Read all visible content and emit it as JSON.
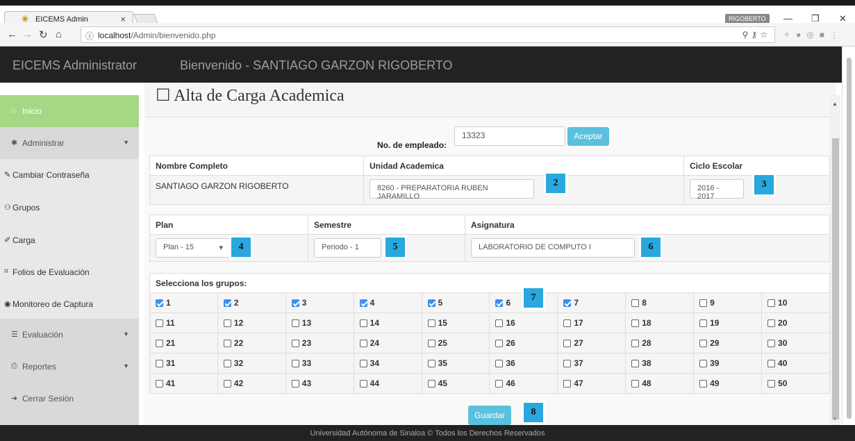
{
  "browser": {
    "tab_title": "EICEMS Admin",
    "tab_close": "×",
    "profile_name": "RIGOBERTO",
    "url_host": "localhost",
    "url_path": "/Admin/bienvenido.php"
  },
  "header": {
    "brand": "EICEMS Administrator",
    "welcome": "Bienvenido - SANTIAGO GARZON RIGOBERTO"
  },
  "sidebar": {
    "items": [
      {
        "label": "Inicio",
        "icon": "home-icon",
        "glyph": "⌂"
      },
      {
        "label": "Administrar",
        "icon": "gear-icon",
        "glyph": "✱"
      },
      {
        "label": "Cambiar Contraseña",
        "icon": "pencil-icon",
        "glyph": "✎"
      },
      {
        "label": "Grupos",
        "icon": "users-icon",
        "glyph": "⚇"
      },
      {
        "label": "Carga",
        "icon": "edit-icon",
        "glyph": "✐"
      },
      {
        "label": "Folios de Evaluación",
        "icon": "sitemap-icon",
        "glyph": "⌗"
      },
      {
        "label": "Monitoreo de Captura",
        "icon": "eye-icon",
        "glyph": "◉"
      },
      {
        "label": "Evaluación",
        "icon": "list-icon",
        "glyph": "☰"
      },
      {
        "label": "Reportes",
        "icon": "print-icon",
        "glyph": "⎙"
      },
      {
        "label": "Cerrar Sesión",
        "icon": "logout-icon",
        "glyph": "➜"
      }
    ]
  },
  "panel": {
    "title": "Alta de Carga Academica"
  },
  "employee": {
    "label": "No. de empleado:",
    "value": "13323",
    "button": "Aceptar"
  },
  "info_table": {
    "headers": [
      "Nombre Completo",
      "Unidad Academica",
      "Ciclo Escolar"
    ],
    "nombre": "SANTIAGO GARZON RIGOBERTO",
    "unidad": "8260 - PREPARATORIA RUBEN JARAMILLO",
    "ciclo": "2016 - 2017"
  },
  "plan_table": {
    "headers": [
      "Plan",
      "Semestre",
      "Asignatura"
    ],
    "plan": "Plan - 15",
    "semestre": "Periodo - 1",
    "asignatura": "LABORATORIO DE COMPUTO I"
  },
  "groups": {
    "header": "Selecciona los grupos:",
    "checked": [
      1,
      2,
      3,
      4,
      5,
      6,
      7
    ],
    "labels": [
      "1",
      "2",
      "3",
      "4",
      "5",
      "6",
      "7",
      "8",
      "9",
      "10",
      "11",
      "12",
      "13",
      "14",
      "15",
      "16",
      "17",
      "18",
      "19",
      "20",
      "21",
      "22",
      "23",
      "24",
      "25",
      "26",
      "27",
      "28",
      "29",
      "30",
      "31",
      "32",
      "33",
      "34",
      "35",
      "36",
      "37",
      "38",
      "39",
      "40",
      "41",
      "42",
      "43",
      "44",
      "45",
      "46",
      "47",
      "48",
      "49",
      "50"
    ]
  },
  "save_button": "Guardar",
  "callouts": [
    "2",
    "3",
    "4",
    "5",
    "6",
    "7",
    "8"
  ],
  "footer": "Universidad Autónoma de Sinaloa © Todos los Derechos Reservados",
  "colors": {
    "active_sidebar": "#a6d785",
    "button_info": "#5bc0de",
    "callout": "#29a8e0",
    "header_bg": "#222222"
  }
}
